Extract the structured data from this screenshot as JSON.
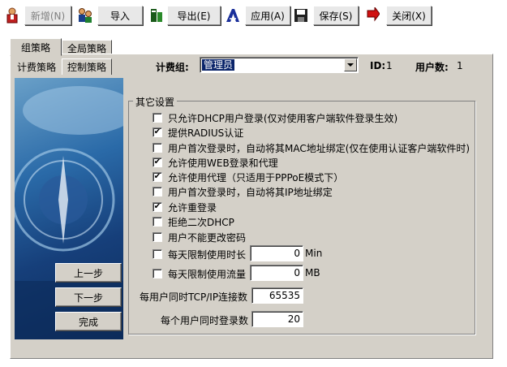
{
  "toolbar": {
    "new_label": "新增(N)",
    "import_label": "导入",
    "export_label": "导出(E)",
    "apply_label": "应用(A)",
    "save_label": "保存(S)",
    "close_label": "关闭(X)"
  },
  "tabs_top": {
    "group_policy": "组策略",
    "global_policy": "全局策略"
  },
  "tabs_sub": {
    "billing": "计费策略",
    "control": "控制策略"
  },
  "header": {
    "group_label": "计费组:",
    "group_value": "管理员",
    "id_label": "ID:",
    "id_value": "1",
    "users_label": "用户数:",
    "users_value": "1"
  },
  "wizard": {
    "prev": "上一步",
    "next": "下一步",
    "finish": "完成"
  },
  "other_settings": {
    "title": "其它设置",
    "options": [
      {
        "label": "只允许DHCP用户登录(仅对使用客户端软件登录生效)",
        "checked": false
      },
      {
        "label": "提供RADIUS认证",
        "checked": true
      },
      {
        "label": "用户首次登录时，自动将其MAC地址绑定(仅在使用认证客户端软件时)",
        "checked": false
      },
      {
        "label": "允许使用WEB登录和代理",
        "checked": true
      },
      {
        "label": "允许使用代理（只适用于PPPoE模式下）",
        "checked": true
      },
      {
        "label": "用户首次登录时，自动将其IP地址绑定",
        "checked": false
      },
      {
        "label": "允许重登录",
        "checked": true
      },
      {
        "label": "拒绝二次DHCP",
        "checked": false
      },
      {
        "label": "用户不能更改密码",
        "checked": false
      }
    ],
    "daily_time": {
      "label": "每天限制使用时长",
      "checked": false,
      "value": "0",
      "unit": "Min"
    },
    "daily_flow": {
      "label": "每天限制使用流量",
      "checked": false,
      "value": "0",
      "unit": "MB"
    },
    "tcp_ip": {
      "label": "每用户同时TCP/IP连接数",
      "value": "65535"
    },
    "max_login": {
      "label": "每个用户同时登录数",
      "value": "20"
    }
  },
  "colors": {
    "panel": "#d4d0c8",
    "selection": "#0a246a",
    "image_dark": "#163f7a"
  }
}
